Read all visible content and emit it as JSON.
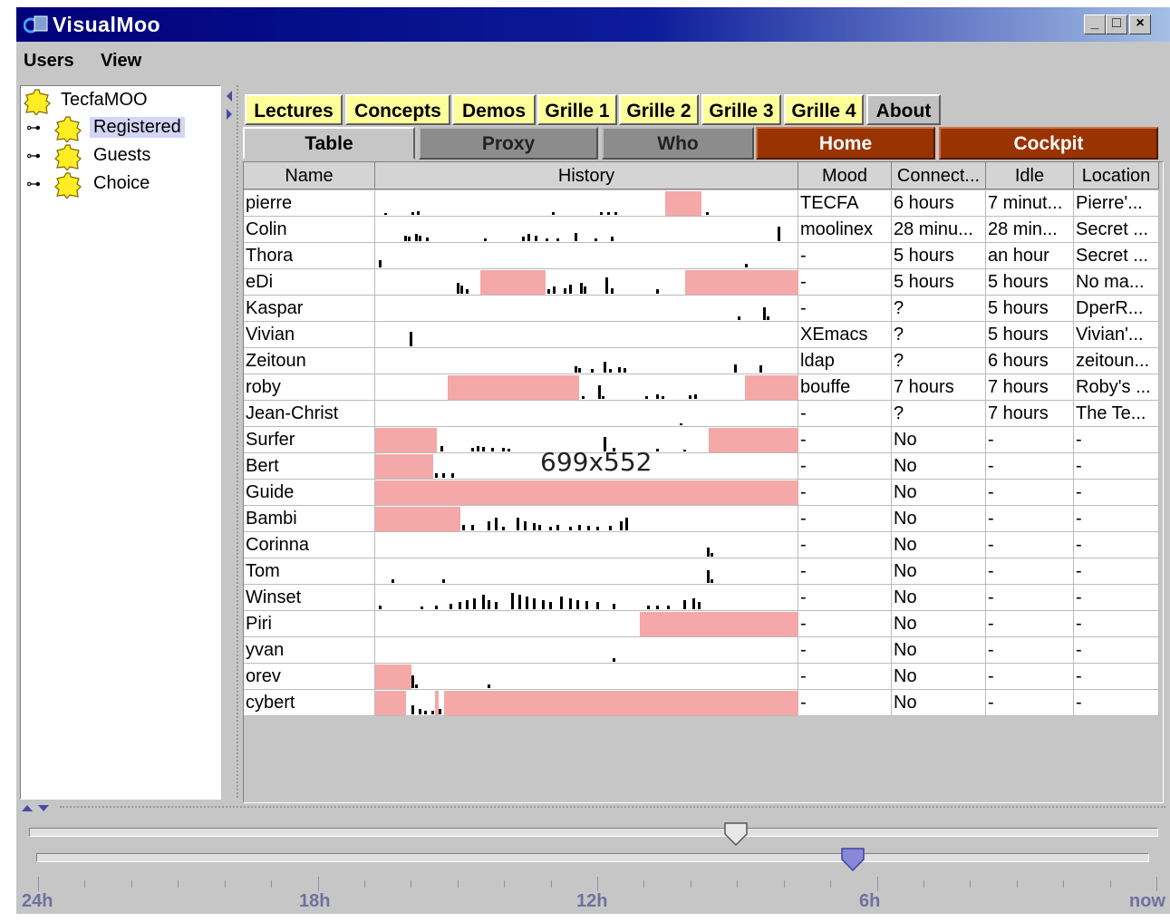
{
  "window": {
    "title": "VisualMoo",
    "minimize": "_",
    "maximize": "□",
    "close": "×"
  },
  "menu": [
    "Users",
    "View"
  ],
  "tree": {
    "root": "TecfaMOO",
    "children": [
      {
        "label": "Registered",
        "selected": true
      },
      {
        "label": "Guests",
        "selected": false
      },
      {
        "label": "Choice",
        "selected": false
      }
    ]
  },
  "tabs_top": [
    "Lectures",
    "Concepts",
    "Demos",
    "Grille 1",
    "Grille 2",
    "Grille 3",
    "Grille 4",
    "About"
  ],
  "tabs_view": [
    "Table",
    "Proxy",
    "Who",
    "Home",
    "Cockpit"
  ],
  "table": {
    "headers": [
      "Name",
      "History",
      "Mood",
      "Connect...",
      "Idle",
      "Location"
    ],
    "rows": [
      {
        "name": "pierre",
        "mood": "TECFA",
        "connect": "6 hours",
        "idle": "7 minut...",
        "location": "Pierre'..."
      },
      {
        "name": "Colin",
        "mood": "moolinex",
        "connect": "28 minu...",
        "idle": "28 min...",
        "location": "Secret ..."
      },
      {
        "name": "Thora",
        "mood": "-",
        "connect": "5 hours",
        "idle": "an hour",
        "location": "Secret ..."
      },
      {
        "name": "eDi",
        "mood": "-",
        "connect": "5 hours",
        "idle": "5 hours",
        "location": "No ma..."
      },
      {
        "name": "Kaspar",
        "mood": "-",
        "connect": "?",
        "idle": "5 hours",
        "location": "DperR..."
      },
      {
        "name": "Vivian",
        "mood": "XEmacs",
        "connect": "?",
        "idle": "5 hours",
        "location": "Vivian'..."
      },
      {
        "name": "Zeitoun",
        "mood": "ldap",
        "connect": "?",
        "idle": "6 hours",
        "location": "zeitoun..."
      },
      {
        "name": "roby",
        "mood": "bouffe",
        "connect": "7 hours",
        "idle": "7 hours",
        "location": "Roby's ..."
      },
      {
        "name": "Jean-Christ",
        "mood": "-",
        "connect": "?",
        "idle": "7 hours",
        "location": "The Te..."
      },
      {
        "name": "Surfer",
        "mood": "-",
        "connect": "No",
        "idle": "-",
        "location": "-"
      },
      {
        "name": "Bert",
        "mood": "-",
        "connect": "No",
        "idle": "-",
        "location": "-"
      },
      {
        "name": "Guide",
        "mood": "-",
        "connect": "No",
        "idle": "-",
        "location": "-"
      },
      {
        "name": "Bambi",
        "mood": "-",
        "connect": "No",
        "idle": "-",
        "location": "-"
      },
      {
        "name": "Corinna",
        "mood": "-",
        "connect": "No",
        "idle": "-",
        "location": "-"
      },
      {
        "name": "Tom",
        "mood": "-",
        "connect": "No",
        "idle": "-",
        "location": "-"
      },
      {
        "name": "Winset",
        "mood": "-",
        "connect": "No",
        "idle": "-",
        "location": "-"
      },
      {
        "name": "Piri",
        "mood": "-",
        "connect": "No",
        "idle": "-",
        "location": "-"
      },
      {
        "name": "yvan",
        "mood": "-",
        "connect": "No",
        "idle": "-",
        "location": "-"
      },
      {
        "name": "orev",
        "mood": "-",
        "connect": "No",
        "idle": "-",
        "location": "-"
      },
      {
        "name": "cybert",
        "mood": "-",
        "connect": "No",
        "idle": "-",
        "location": "-"
      }
    ]
  },
  "history_colors": {
    "connected": "#f4a8a8",
    "activity": "#000000"
  },
  "overlay": "699x552",
  "timeline": {
    "labels": [
      "24h",
      "18h",
      "12h",
      "6h",
      "now"
    ]
  }
}
